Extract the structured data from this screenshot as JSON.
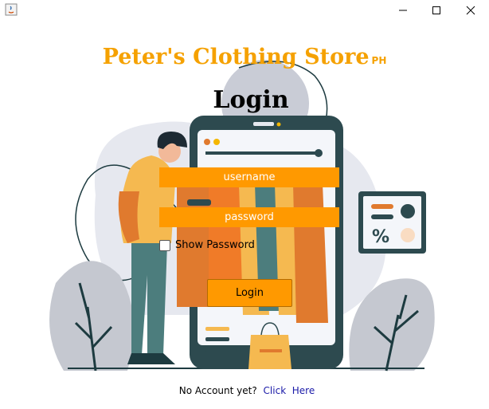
{
  "window": {
    "title": ""
  },
  "titlebar": {
    "app_icon": "java-icon",
    "minimize_icon": "minimize-icon",
    "maximize_icon": "maximize-icon",
    "close_icon": "close-icon"
  },
  "store": {
    "name": "Peter's Clothing Store",
    "suffix": "PH"
  },
  "login": {
    "heading": "Login",
    "username_placeholder": "username",
    "password_placeholder": "password",
    "show_password_label": "Show Password",
    "button_label": "Login"
  },
  "footer": {
    "prompt": "No Account yet?",
    "link_label": "Click  Here"
  },
  "colors": {
    "accent": "#ff9900",
    "title": "#f5a100",
    "link": "#1a1aa8"
  }
}
